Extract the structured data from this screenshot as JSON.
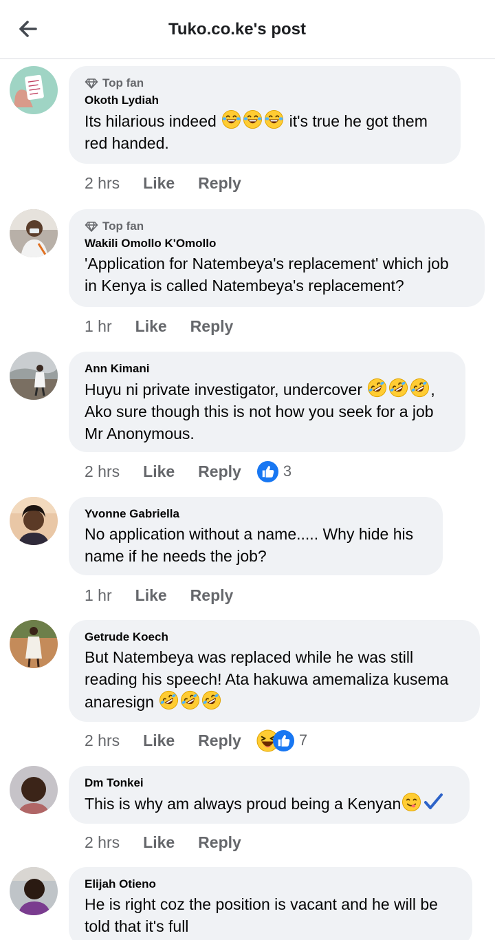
{
  "header": {
    "title": "Tuko.co.ke's post",
    "back_icon": "arrow-left-icon"
  },
  "labels": {
    "top_fan": "Top fan",
    "like": "Like",
    "reply": "Reply"
  },
  "comments": [
    {
      "author": "Okoth Lydiah",
      "top_fan": true,
      "line1": "Its hilarious indeed",
      "line1_after": " it's true he got them",
      "line2": "red handed.",
      "time": "2 hrs"
    },
    {
      "author": "Wakili Omollo K'Omollo",
      "top_fan": true,
      "line1": "'Application for Natembeya's replacement' which job",
      "line2": "in Kenya is called Natembeya's replacement?",
      "time": "1 hr"
    },
    {
      "author": "Ann Kimani",
      "top_fan": false,
      "line1": "Huyu ni private investigator, undercover",
      "line1_after": ",",
      "line2": "Ako sure though this is not how you seek for a job",
      "line3": "Mr Anonymous.",
      "time": "2 hrs",
      "reaction_count": "3"
    },
    {
      "author": "Yvonne Gabriella",
      "top_fan": false,
      "line1": "No application without a name..... Why hide his",
      "line2": "name if he needs the job?",
      "time": "1 hr"
    },
    {
      "author": "Getrude Koech",
      "top_fan": false,
      "line1": "But Natembeya was replaced while he was still",
      "line2": "reading his speech! Ata hakuwa amemaliza kusema",
      "line3": "anaresign",
      "time": "2 hrs",
      "reaction_count": "7"
    },
    {
      "author": "Dm Tonkei",
      "top_fan": false,
      "line1": "This is why am always proud being a Kenyan",
      "time": "2 hrs"
    },
    {
      "author": "Elijah Otieno",
      "top_fan": false,
      "line1": "He is right coz the position is vacant and he will be",
      "line2": "told that it's full"
    }
  ],
  "colors": {
    "bubble": "#f0f2f5",
    "muted": "#65676b",
    "like_blue": "#1877f2",
    "emoji_yellow": "#ffcc33"
  }
}
